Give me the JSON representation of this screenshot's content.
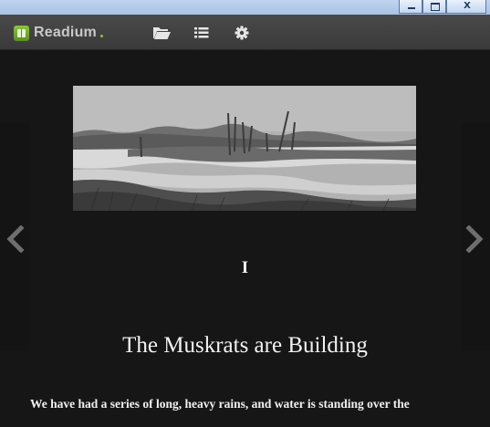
{
  "window": {
    "minimize_glyph": "",
    "close_glyph": "X"
  },
  "toolbar": {
    "brand_name": "Readium",
    "icons": [
      "book-logo-icon",
      "folder-open-icon",
      "list-icon",
      "gear-icon"
    ]
  },
  "book": {
    "chapter_number": "I",
    "chapter_title": "The Muskrats are Building",
    "first_line_lead": "We",
    "first_line_rest": " have had a series of long, heavy rains, and water is standing over the"
  },
  "colors": {
    "toolbar": "#3f3f3f",
    "reader_bg": "#161616",
    "accent": "#8cc63f",
    "text": "#f2f2f2"
  }
}
